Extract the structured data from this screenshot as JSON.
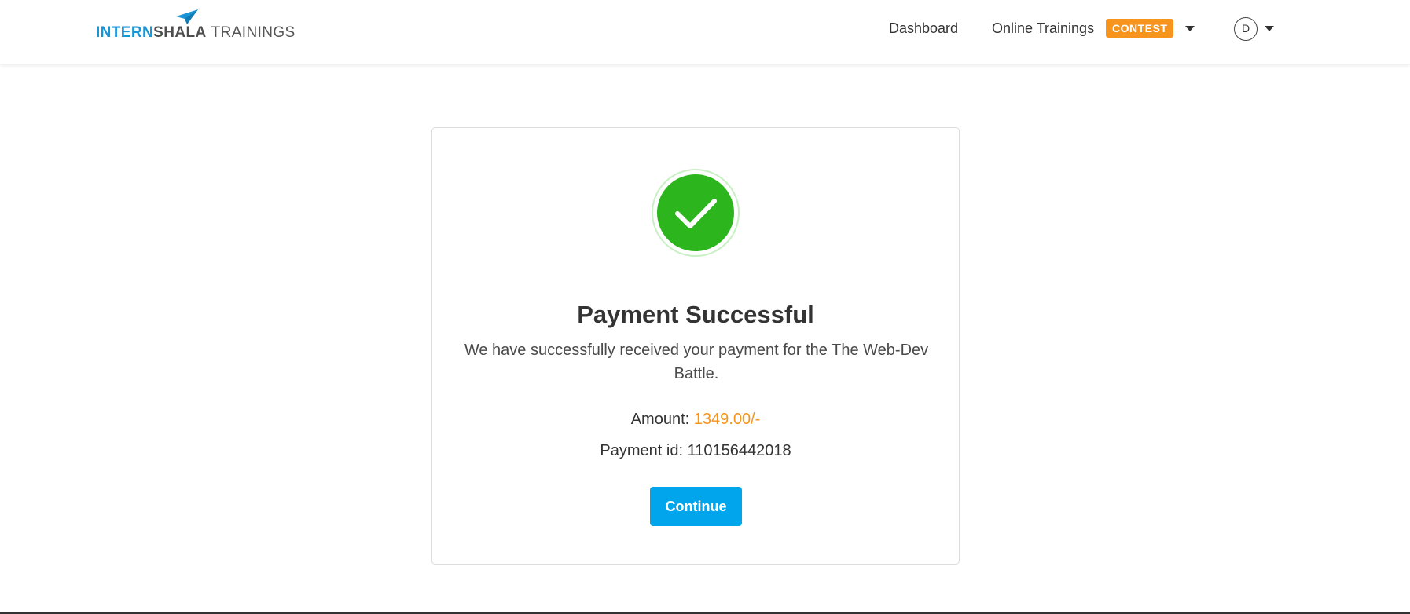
{
  "header": {
    "logo": {
      "part1": "INTERN",
      "part2": "SHALA",
      "part3": "TRAININGS",
      "icon": "paper-plane-icon"
    },
    "nav": {
      "dashboard": "Dashboard",
      "online_trainings": "Online Trainings",
      "contest_badge": "CONTEST"
    },
    "avatar_initial": "D"
  },
  "card": {
    "icon": "check-circle-icon",
    "title": "Payment Successful",
    "message": "We have successfully received your payment for the The Web-Dev Battle.",
    "amount_label": "Amount: ",
    "amount_value": "1349.00/-",
    "payment_id_label": "Payment id: ",
    "payment_id_value": "110156442018",
    "continue_label": "Continue"
  },
  "colors": {
    "brand_blue": "#1a95d6",
    "badge_orange": "#f7941d",
    "success_green": "#2db51e",
    "button_blue": "#00a5ec"
  }
}
